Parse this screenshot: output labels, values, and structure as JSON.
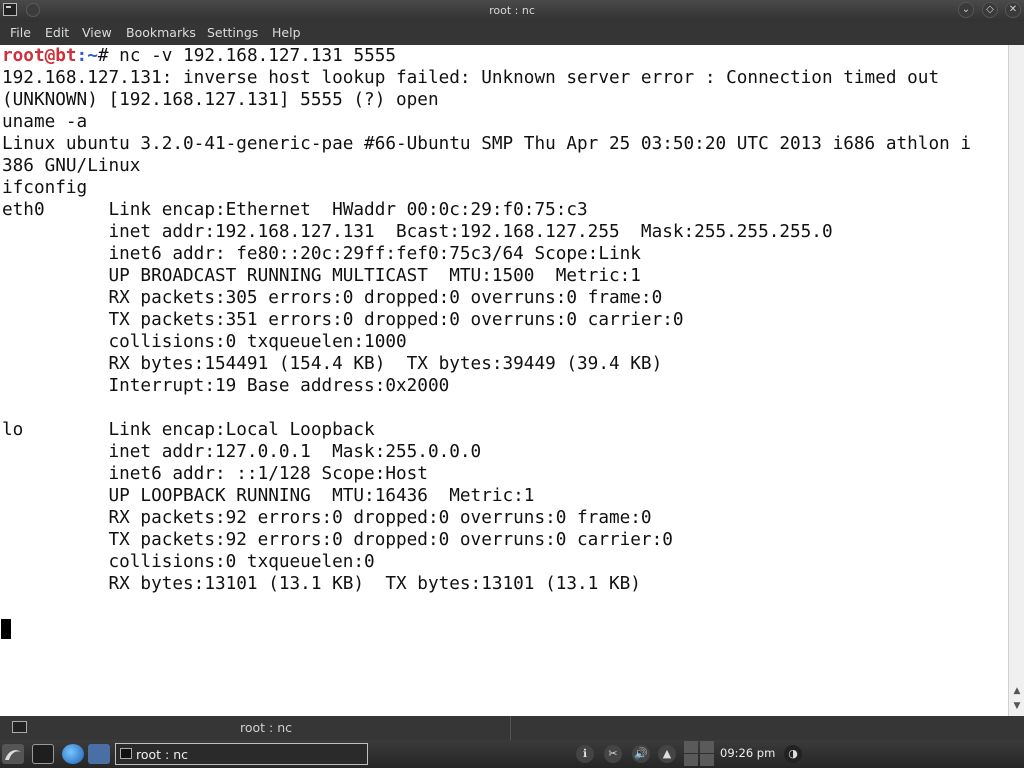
{
  "window": {
    "title": "root : nc"
  },
  "menu": {
    "items": [
      "File",
      "Edit",
      "View",
      "Bookmarks",
      "Settings",
      "Help"
    ]
  },
  "terminal": {
    "prompt_user": "root@bt",
    "prompt_path": ":~",
    "prompt_symbol": "# ",
    "command": "nc -v 192.168.127.131 5555",
    "lines": [
      "192.168.127.131: inverse host lookup failed: Unknown server error : Connection timed out",
      "(UNKNOWN) [192.168.127.131] 5555 (?) open",
      "uname -a",
      "Linux ubuntu 3.2.0-41-generic-pae #66-Ubuntu SMP Thu Apr 25 03:50:20 UTC 2013 i686 athlon i",
      "386 GNU/Linux",
      "ifconfig",
      "eth0      Link encap:Ethernet  HWaddr 00:0c:29:f0:75:c3  ",
      "          inet addr:192.168.127.131  Bcast:192.168.127.255  Mask:255.255.255.0",
      "          inet6 addr: fe80::20c:29ff:fef0:75c3/64 Scope:Link",
      "          UP BROADCAST RUNNING MULTICAST  MTU:1500  Metric:1",
      "          RX packets:305 errors:0 dropped:0 overruns:0 frame:0",
      "          TX packets:351 errors:0 dropped:0 overruns:0 carrier:0",
      "          collisions:0 txqueuelen:1000 ",
      "          RX bytes:154491 (154.4 KB)  TX bytes:39449 (39.4 KB)",
      "          Interrupt:19 Base address:0x2000 ",
      "",
      "lo        Link encap:Local Loopback  ",
      "          inet addr:127.0.0.1  Mask:255.0.0.0",
      "          inet6 addr: ::1/128 Scope:Host",
      "          UP LOOPBACK RUNNING  MTU:16436  Metric:1",
      "          RX packets:92 errors:0 dropped:0 overruns:0 frame:0",
      "          TX packets:92 errors:0 dropped:0 overruns:0 carrier:0",
      "          collisions:0 txqueuelen:0 ",
      "          RX bytes:13101 (13.1 KB)  TX bytes:13101 (13.1 KB)"
    ]
  },
  "tabbar": {
    "tab_title": "root : nc"
  },
  "taskbar": {
    "task_label": "root : nc",
    "clock": "09:26 pm"
  },
  "colors": {
    "prompt_user": "#d0303a",
    "prompt_path": "#3060d0",
    "terminal_bg": "#ffffff"
  }
}
